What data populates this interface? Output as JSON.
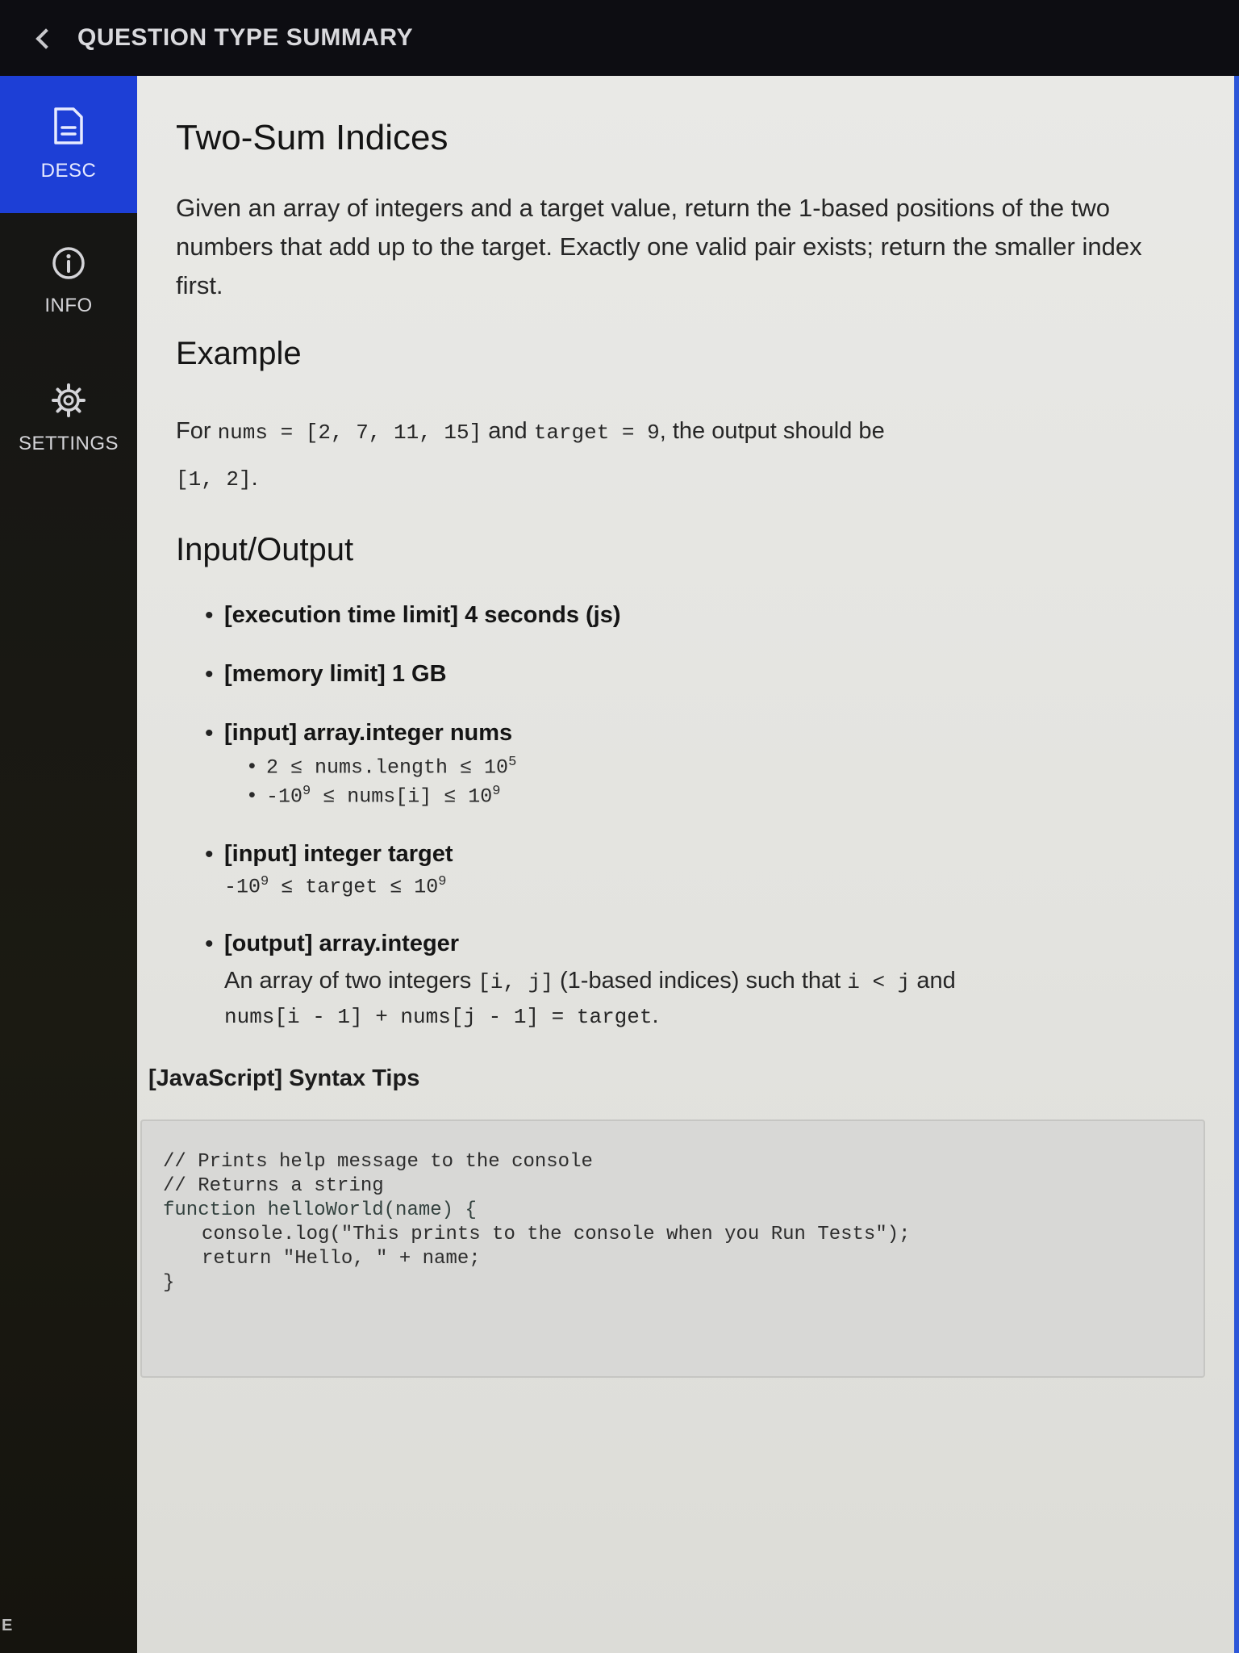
{
  "header": {
    "title": "QUESTION TYPE SUMMARY"
  },
  "sidebar": {
    "items": [
      {
        "label": "DESC",
        "icon": "document-icon",
        "active": true
      },
      {
        "label": "INFO",
        "icon": "info-icon",
        "active": false
      },
      {
        "label": "SETTINGS",
        "icon": "gear-icon",
        "active": false
      }
    ],
    "footer_text": "E"
  },
  "main": {
    "title": "Two-Sum Indices",
    "description": "Given an array of integers and a target value, return the 1-based positions of the two numbers that add up to the target. Exactly one valid pair exists; return the smaller index first.",
    "example": {
      "heading": "Example",
      "prefix": "For ",
      "nums_code": "nums = [2, 7, 11, 15]",
      "joiner": " and ",
      "target_code": "target = 9",
      "suffix": ", the output should be",
      "output_code": "[1, 2]",
      "period": "."
    },
    "io": {
      "heading": "Input/Output",
      "time_limit": "[execution time limit] 4 seconds (js)",
      "memory_limit": "[memory limit] 1 GB",
      "input_nums": {
        "label": "[input] array.integer nums",
        "c1_left": "2 ≤ nums.length ≤ 10",
        "c1_exp": "5",
        "c2_left": "-10",
        "c2_exp1": "9",
        "c2_mid": " ≤ nums[i] ≤ 10",
        "c2_exp2": "9"
      },
      "input_target": {
        "label": "[input] integer target",
        "left": "-10",
        "exp1": "9",
        "mid": " ≤ target ≤ 10",
        "exp2": "9"
      },
      "output": {
        "label": "[output] array.integer",
        "text_a": "An array of two integers ",
        "code_a": "[i, j]",
        "text_b": " (1-based indices) such that ",
        "code_b": "i < j",
        "text_c": " and",
        "code_c": "nums[i - 1] + nums[j - 1] = target",
        "text_d": "."
      }
    },
    "tips": {
      "heading": "[JavaScript] Syntax Tips",
      "code": {
        "line1": "// Prints help message to the console",
        "line2": "// Returns a string",
        "line3": "function helloWorld(name) {",
        "line4": "console.log(\"This prints to the console when you Run Tests\");",
        "line5": "return \"Hello, \" + name;",
        "line6": "}"
      }
    }
  },
  "colors": {
    "header_bg": "#0d0d12",
    "sidebar_active": "#1d3fd6",
    "content_bg": "#e9e9e6",
    "accent_border": "#2c56d8"
  }
}
